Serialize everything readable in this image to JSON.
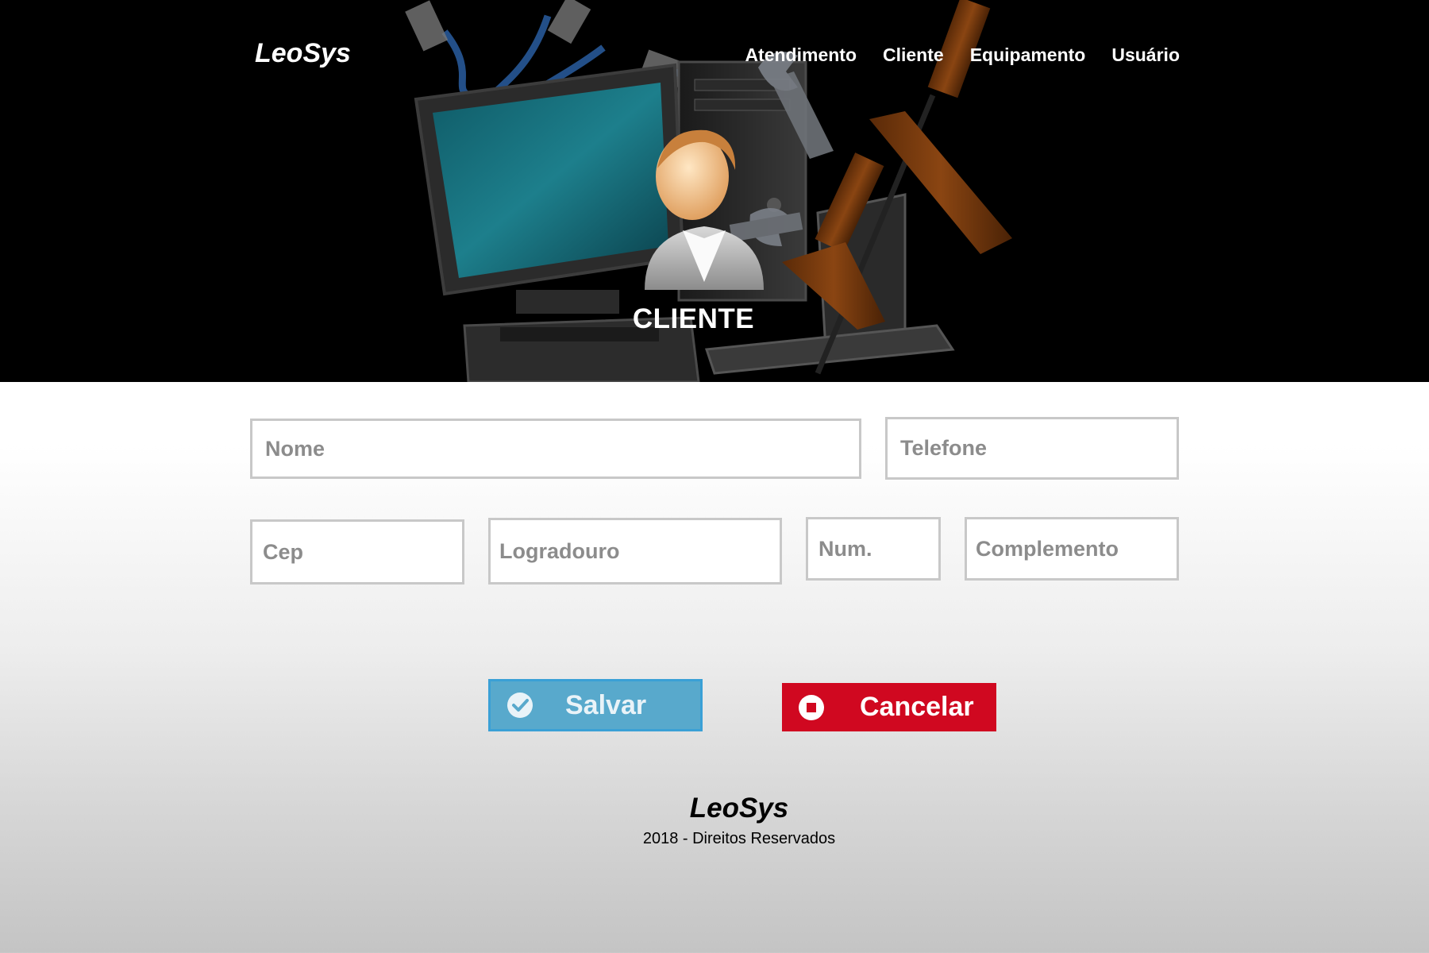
{
  "header": {
    "brand": "LeoSys",
    "nav": [
      "Atendimento",
      "Cliente",
      "Equipamento",
      "Usuário"
    ],
    "page_title": "CLIENTE"
  },
  "form": {
    "nome_placeholder": "Nome",
    "telefone_placeholder": "Telefone",
    "cep_placeholder": "Cep",
    "logradouro_placeholder": "Logradouro",
    "num_placeholder": "Num.",
    "complemento_placeholder": "Complemento"
  },
  "buttons": {
    "save_label": "Salvar",
    "save_icon": "check-circle-icon",
    "save_color": "#58a9cc",
    "cancel_label": "Cancelar",
    "cancel_icon": "stop-circle-icon",
    "cancel_color": "#d00820"
  },
  "footer": {
    "brand": "LeoSys",
    "copyright": "2018 - Direitos Reservados"
  }
}
